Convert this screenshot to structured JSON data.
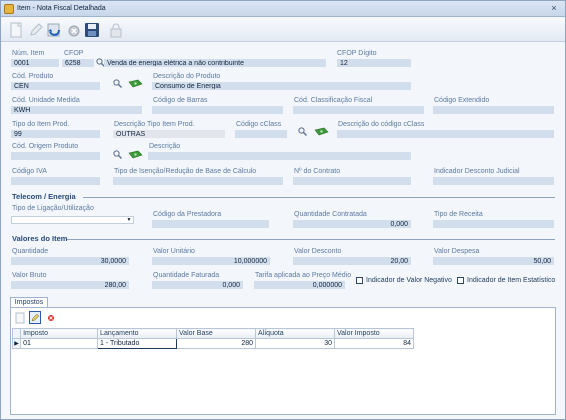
{
  "window": {
    "title": "Item - Nota Fiscal Detalhada",
    "close_glyph": "×"
  },
  "toolbar": {
    "buttons": [
      {
        "name": "new-icon"
      },
      {
        "name": "edit-icon"
      },
      {
        "name": "undo-icon"
      },
      {
        "name": "cancel-icon"
      },
      {
        "name": "save-icon"
      },
      {
        "name": "lock-icon"
      }
    ]
  },
  "header": {
    "num_item_label": "Núm. Item",
    "num_item_value": "0001",
    "cfop_label": "CFOP",
    "cfop_code": "6258",
    "cfop_desc": "Venda de energia elétrica a não contribuinte",
    "cfop_digito_label": "CFOP Dígito",
    "cfop_digito_value": "12"
  },
  "produto": {
    "cod_label": "Cód. Produto",
    "cod_value": "CEN",
    "desc_label": "Descrição do Produto",
    "desc_value": "Consumo de Energia"
  },
  "row3": {
    "unidade_label": "Cód. Unidade Medida",
    "unidade_value": "KWH",
    "barras_label": "Código de Barras",
    "barras_value": "",
    "fiscal_label": "Cód. Classificação Fiscal",
    "fiscal_value": "",
    "estendido_label": "Código Extendido",
    "estendido_value": ""
  },
  "row4": {
    "tipo_label": "Tipo do Item Prod.",
    "tipo_value": "99",
    "desc_tipo_label": "Descrição Tipo Item Prod.",
    "desc_tipo_value": "OUTRAS",
    "cclass_label": "Código cClass",
    "cclass_value": "",
    "desc_cclass_label": "Descrição do código cClass",
    "desc_cclass_value": ""
  },
  "row5": {
    "origem_label": "Cód. Origem Produto",
    "origem_value": "",
    "descricao_label": "Descrição",
    "descricao_value": ""
  },
  "row6": {
    "iva_label": "Código IVA",
    "iva_value": "",
    "isencao_label": "Tipo de Isenção/Redução de Base de Cálculo",
    "isencao_value": "",
    "contrato_label": "Nº do Contrato",
    "contrato_value": "",
    "judicial_label": "Indicador Desconto Judicial",
    "judicial_value": ""
  },
  "telecom": {
    "section": "Telecom / Energia",
    "ligacao_label": "Tipo de Ligação/Utilização",
    "ligacao_value": "",
    "prestadora_label": "Código da Prestadora",
    "prestadora_value": "",
    "quantidade_contratada_label": "Quantidade Contratada",
    "quantidade_contratada_value": "0,000",
    "receita_label": "Tipo de Receita",
    "receita_value": ""
  },
  "valores": {
    "section": "Valores do Item",
    "quantidade_label": "Quantidade",
    "quantidade_value": "30,0000",
    "unitario_label": "Valor Unitário",
    "unitario_value": "10,000000",
    "desconto_label": "Valor Desconto",
    "desconto_value": "20,00",
    "despesa_label": "Valor Despesa",
    "despesa_value": "50,00",
    "bruto_label": "Valor Bruto",
    "bruto_value": "280,00",
    "faturada_label": "Quantidade Faturada",
    "faturada_value": "0,000",
    "tarifa_label": "Tarifa aplicada ao Preço Médio",
    "tarifa_value": "0,000000",
    "negativo_label": "Indicador de Valor Negativo",
    "estatistico_label": "Indicador de Item Estatístico"
  },
  "impostos": {
    "tab_label": "Impostos",
    "columns": [
      "Imposto",
      "Lançamento",
      "Valor Base",
      "Alíquota",
      "Valor Imposto"
    ],
    "rows": [
      {
        "indicator": "▶",
        "imposto": "01",
        "lancamento": "1 - Tributado",
        "base": "280",
        "aliquota": "30",
        "valor": "84"
      }
    ]
  }
}
